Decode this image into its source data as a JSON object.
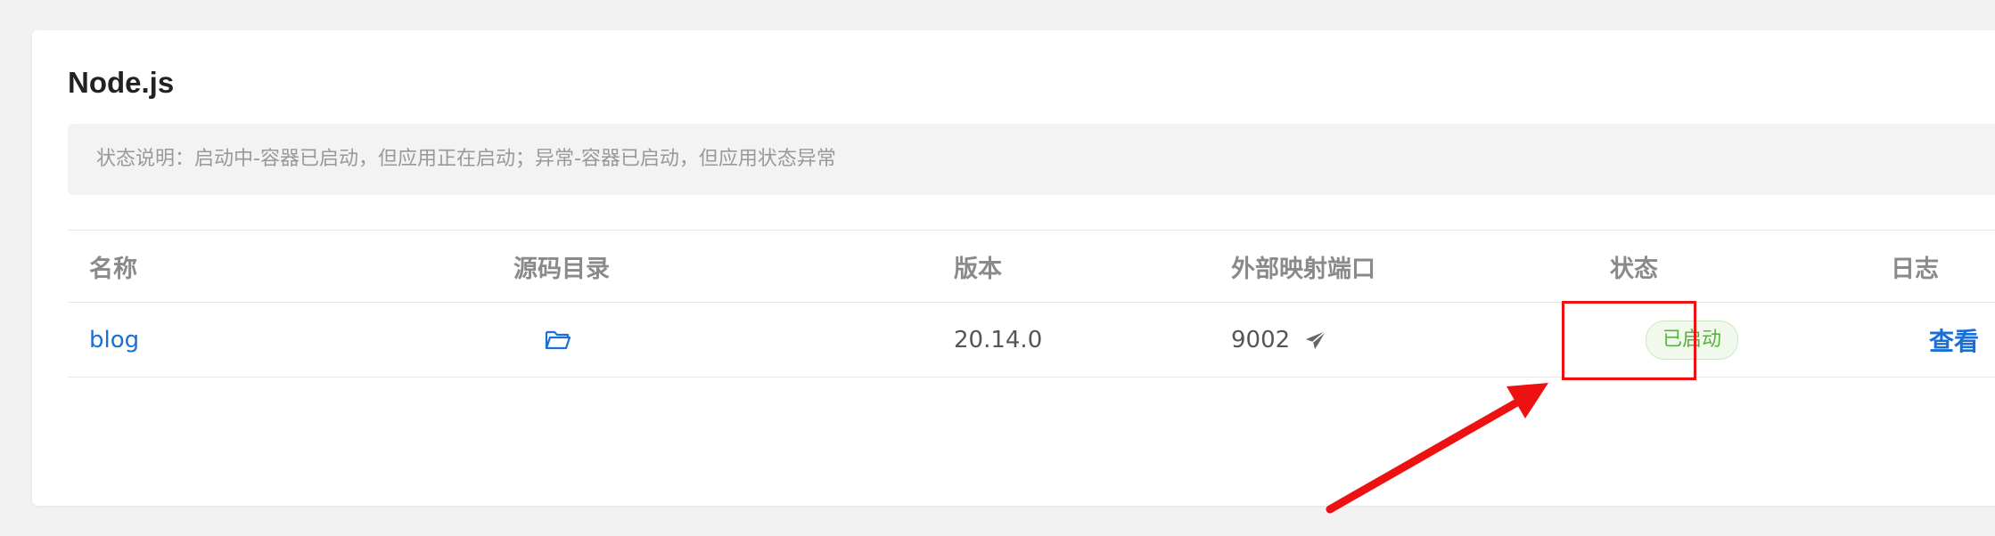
{
  "panel": {
    "title": "Node.js",
    "notice": "状态说明：启动中-容器已启动，但应用正在启动；异常-容器已启动，但应用状态异常"
  },
  "table": {
    "headers": [
      "名称",
      "源码目录",
      "版本",
      "外部映射端口",
      "状态",
      "日志"
    ],
    "rows": [
      {
        "name": "blog",
        "source_icon": "folder-open-icon",
        "version": "20.14.0",
        "port": "9002",
        "port_icon": "send-icon",
        "status": "已启动",
        "log_action": "查看"
      }
    ]
  },
  "colors": {
    "link": "#1a6fd6",
    "status_ok": "#55b43a",
    "annotation": "#ee1111"
  }
}
